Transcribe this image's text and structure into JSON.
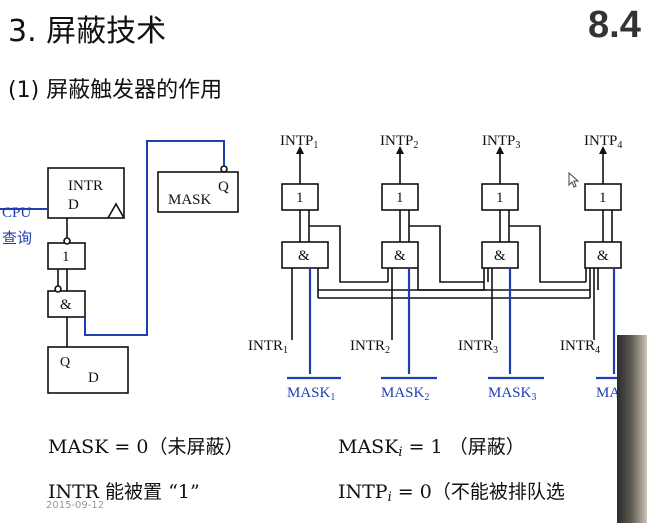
{
  "header": {
    "title": "3. 屏蔽技术",
    "section_number": "8.4",
    "subtitle": "(1) 屏蔽触发器的作用"
  },
  "left_circuit": {
    "intr_flipflop_top": "INTR",
    "intr_flipflop_d": "D",
    "mask_label": "MASK",
    "mask_q": "Q",
    "cpu_label": "CPU",
    "query_label": "查询",
    "or_gate_label": "1",
    "and_gate_label": "&",
    "lower_flipflop_q": "Q",
    "lower_flipflop_d": "D"
  },
  "right_circuit": {
    "intp_labels": [
      {
        "name": "INTP",
        "sub": "1"
      },
      {
        "name": "INTP",
        "sub": "2"
      },
      {
        "name": "INTP",
        "sub": "3"
      },
      {
        "name": "INTP",
        "sub": "4"
      }
    ],
    "or_gate_label": "1",
    "and_gate_label": "&",
    "intr_labels": [
      {
        "name": "INTR",
        "sub": "1"
      },
      {
        "name": "INTR",
        "sub": "2"
      },
      {
        "name": "INTR",
        "sub": "3"
      },
      {
        "name": "INTR",
        "sub": "4"
      }
    ],
    "mask_labels": [
      {
        "name": "MASK",
        "sub": "1"
      },
      {
        "name": "MASK",
        "sub": "2"
      },
      {
        "name": "MASK",
        "sub": "3"
      },
      {
        "name": "MA",
        "sub": ""
      }
    ]
  },
  "bottom_text": {
    "line1_left": "MASK = 0（未屏蔽）",
    "line1_right_main": "MASK",
    "line1_right_sub": "i",
    "line1_right_rest": " = 1 （屏蔽）",
    "line2_left": "INTR  能被置 “1”",
    "line2_right_main": "INTP",
    "line2_right_sub": "i",
    "line2_right_rest": "  = 0（不能被排队选",
    "date": "2015-09-12"
  },
  "colors": {
    "wire_black": "#111111",
    "wire_blue": "#1f3fb0",
    "text_blue": "#1f3fb0"
  }
}
